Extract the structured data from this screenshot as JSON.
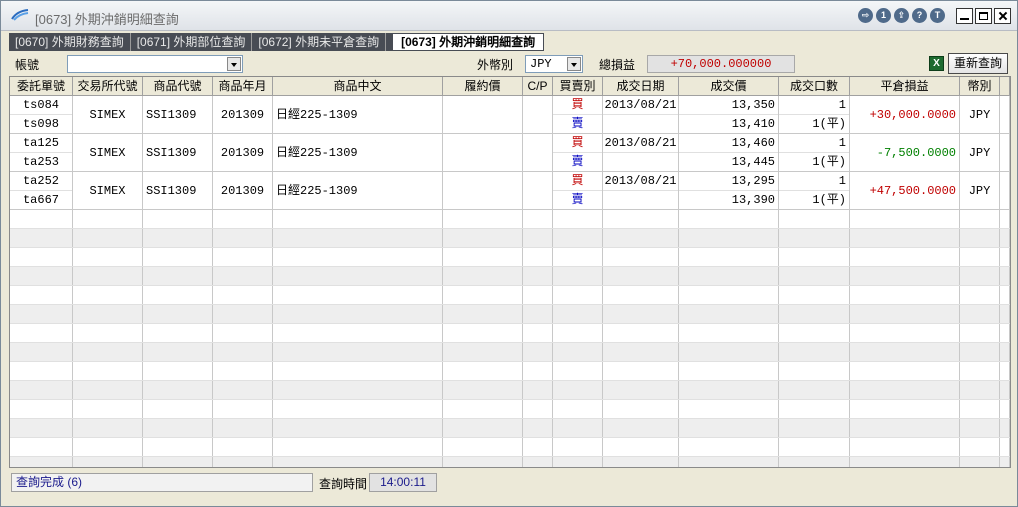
{
  "window": {
    "title": "[0673] 外期沖銷明細查詢",
    "icon_buttons": [
      "⇨",
      "1",
      "⇪",
      "?",
      "T"
    ]
  },
  "tabs": [
    {
      "label": "[0670] 外期財務查詢"
    },
    {
      "label": "[0671] 外期部位查詢"
    },
    {
      "label": "[0672] 外期未平倉查詢"
    },
    {
      "label": "[0673] 外期沖銷明細查詢"
    }
  ],
  "toolbar": {
    "account_label": "帳號",
    "account_value": "",
    "currency_label": "外幣別",
    "currency_value": "JPY",
    "total_label": "總損益",
    "total_value": "+70,000.000000",
    "excel_icon": "X",
    "requery_label": "重新查詢"
  },
  "table": {
    "headers": [
      "委託單號",
      "交易所代號",
      "商品代號",
      "商品年月",
      "商品中文",
      "履約價",
      "C/P",
      "買賣別",
      "成交日期",
      "成交價",
      "成交口數",
      "平倉損益",
      "幣別"
    ],
    "groups": [
      {
        "exchange": "SIMEX",
        "product": "SSI1309",
        "ym": "201309",
        "name": "日經225-1309",
        "strike": "",
        "cp": "",
        "pnl": "+30,000.0000",
        "pnl_sign": "pos",
        "currency": "JPY",
        "legs": [
          {
            "order": "ts084",
            "side": "買",
            "side_type": "buy",
            "date": "2013/08/21",
            "price": "13,350",
            "qty": "1"
          },
          {
            "order": "ts098",
            "side": "賣",
            "side_type": "sell",
            "date": "",
            "price": "13,410",
            "qty": "1(平)"
          }
        ]
      },
      {
        "exchange": "SIMEX",
        "product": "SSI1309",
        "ym": "201309",
        "name": "日經225-1309",
        "strike": "",
        "cp": "",
        "pnl": "-7,500.0000",
        "pnl_sign": "neg",
        "currency": "JPY",
        "legs": [
          {
            "order": "ta125",
            "side": "買",
            "side_type": "buy",
            "date": "2013/08/21",
            "price": "13,460",
            "qty": "1"
          },
          {
            "order": "ta253",
            "side": "賣",
            "side_type": "sell",
            "date": "",
            "price": "13,445",
            "qty": "1(平)"
          }
        ]
      },
      {
        "exchange": "SIMEX",
        "product": "SSI1309",
        "ym": "201309",
        "name": "日經225-1309",
        "strike": "",
        "cp": "",
        "pnl": "+47,500.0000",
        "pnl_sign": "pos",
        "currency": "JPY",
        "legs": [
          {
            "order": "ta252",
            "side": "買",
            "side_type": "buy",
            "date": "2013/08/21",
            "price": "13,295",
            "qty": "1"
          },
          {
            "order": "ta667",
            "side": "賣",
            "side_type": "sell",
            "date": "",
            "price": "13,390",
            "qty": "1(平)"
          }
        ]
      }
    ]
  },
  "status": {
    "message": "查詢完成 (6)",
    "query_time_label": "查詢時間",
    "query_time_value": "14:00:11"
  },
  "colors": {
    "buy": "#c00000",
    "sell": "#0000c0",
    "profit": "#c00000",
    "loss": "#008000",
    "tab_bar": "#484c54"
  }
}
